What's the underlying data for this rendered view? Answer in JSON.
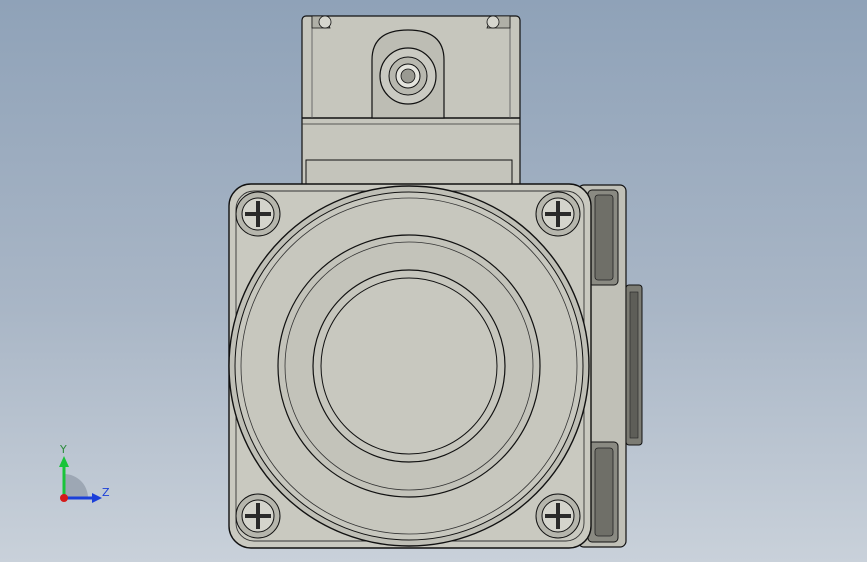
{
  "viewport": {
    "background_top": "#8fa2b8",
    "background_bottom": "#c9d1da"
  },
  "model": {
    "body_color": "#c8c8bf",
    "shade_color": "#aeaea5",
    "dark_color": "#6f6f68",
    "edge_color": "#111111"
  },
  "triad": {
    "y_label": "Y",
    "z_label": "Z",
    "y_color": "#19c43a",
    "z_color": "#1b3fd9",
    "x_color": "#d41a1a",
    "y_label_color": "#2c8c3c",
    "z_label_color": "#1b3fd9"
  }
}
